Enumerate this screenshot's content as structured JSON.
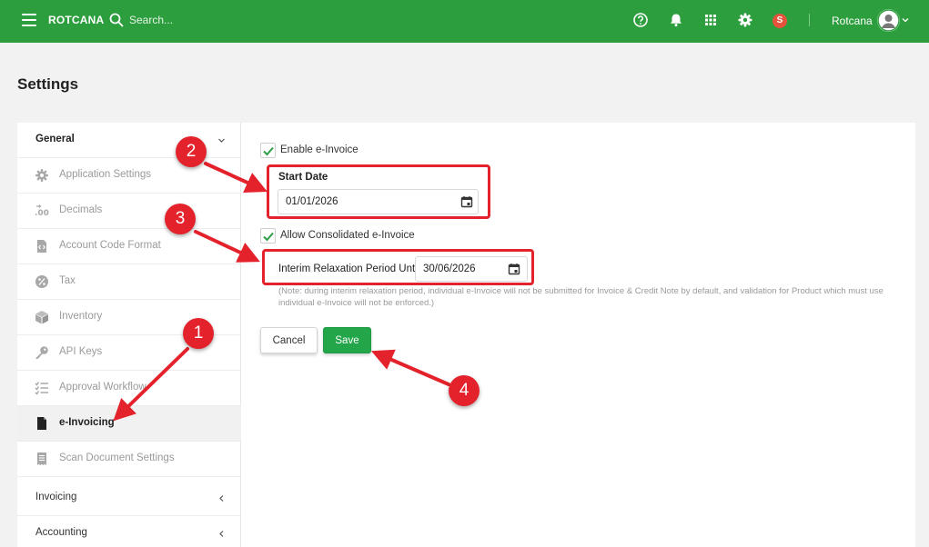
{
  "topbar": {
    "brand": "ROTCANA",
    "search_placeholder": "Search...",
    "user_name": "Rotcana",
    "company_badge": "S",
    "accent": "#2c9e3d"
  },
  "page": {
    "title": "Settings"
  },
  "sidebar": {
    "groups": [
      {
        "label": "General",
        "expanded": true
      },
      {
        "label": "Invoicing",
        "expanded": false
      },
      {
        "label": "Accounting",
        "expanded": false
      }
    ],
    "items": [
      {
        "label": "Application Settings",
        "icon": "gear-icon"
      },
      {
        "label": "Decimals",
        "icon": "decimals-icon"
      },
      {
        "label": "Account Code Format",
        "icon": "code-file-icon"
      },
      {
        "label": "Tax",
        "icon": "percent-icon"
      },
      {
        "label": "Inventory",
        "icon": "box-icon"
      },
      {
        "label": "API Keys",
        "icon": "key-icon"
      },
      {
        "label": "Approval Workflow",
        "icon": "checklist-icon"
      },
      {
        "label": "e-Invoicing",
        "icon": "document-icon",
        "active": true
      },
      {
        "label": "Scan Document Settings",
        "icon": "receipt-icon"
      }
    ]
  },
  "form": {
    "enable_einvoice": {
      "label": "Enable e-Invoice",
      "checked": true
    },
    "start_date": {
      "label": "Start Date",
      "value": "01/01/2026"
    },
    "allow_consolidated": {
      "label": "Allow Consolidated e-Invoice",
      "checked": true
    },
    "interim_period": {
      "label": "Interim Relaxation Period Until",
      "value": "30/06/2026"
    },
    "note": "(Note: during interim relaxation period, individual e-Invoice will not be submitted for Invoice & Credit Note by default, and validation for Product which must use individual e-Invoice will not be enforced.)",
    "cancel_label": "Cancel",
    "save_label": "Save"
  },
  "annotations": {
    "markers": [
      "1",
      "2",
      "3",
      "4"
    ],
    "color": "#e3222b"
  }
}
